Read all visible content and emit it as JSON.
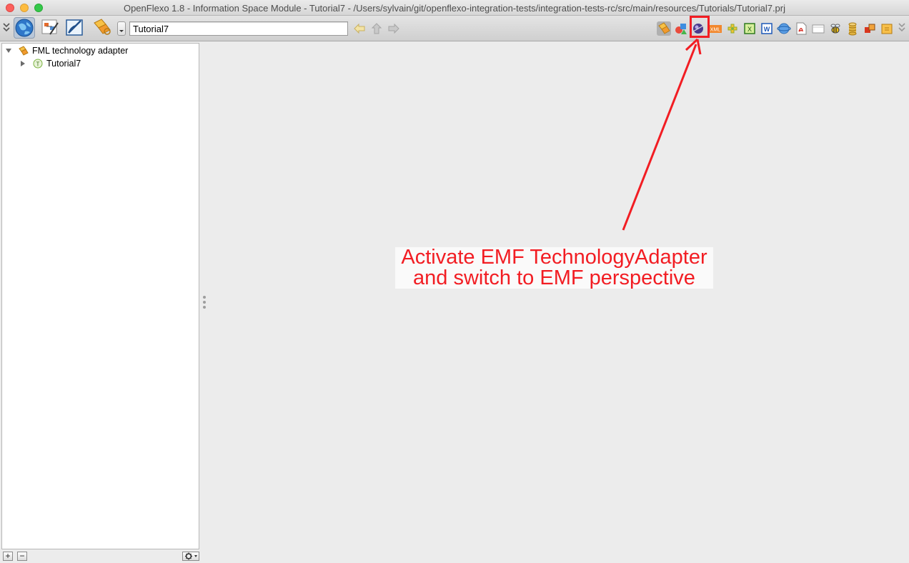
{
  "window": {
    "title": "OpenFlexo 1.8 - Information Space Module - Tutorial7 - /Users/sylvain/git/openflexo-integration-tests/integration-tests-rc/src/main/resources/Tutorials/Tutorial7.prj"
  },
  "toolbar": {
    "modules": [
      {
        "icon": "information-space-globe-icon",
        "active": true
      },
      {
        "icon": "view-editor-icon",
        "active": false
      },
      {
        "icon": "diagram-pen-icon",
        "active": false
      },
      {
        "icon": "fml-technology-adapter-icon",
        "active": false
      }
    ],
    "breadcrumb_value": "Tutorial7",
    "nav": [
      "back-arrow-icon",
      "up-arrow-icon",
      "forward-arrow-icon"
    ],
    "technology_adapters": [
      "fml-adapter-icon",
      "diagram-shapes-icon",
      "emf-adapter-icon",
      "xml-adapter-icon",
      "xsd-puzzle-icon",
      "excel-adapter-icon",
      "word-adapter-icon",
      "owl-adapter-icon",
      "pdf-adapter-icon",
      "docx-adapter-icon",
      "bee-adapter-icon",
      "database-adapter-icon",
      "connie-adapter-icon",
      "archive-adapter-icon"
    ],
    "xml_icon_text": "XML",
    "excel_icon_text": "X",
    "word_icon_text": "W"
  },
  "tree": {
    "root_label": "FML technology adapter",
    "child_label": "Tutorial7"
  },
  "annotation": {
    "line1": "Activate EMF TechnologyAdapter",
    "line2": "and switch to EMF perspective",
    "color": "#f21d23"
  },
  "bottom_bar": {
    "add_label": "+",
    "remove_label": "−"
  }
}
